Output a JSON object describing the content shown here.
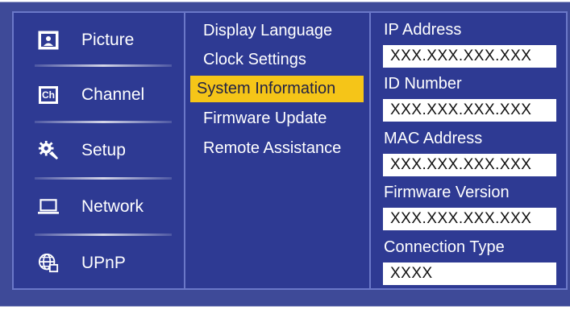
{
  "nav": {
    "items": [
      {
        "label": "Picture",
        "icon": "picture-icon"
      },
      {
        "label": "Channel",
        "icon": "channel-icon",
        "icon_text": "Ch"
      },
      {
        "label": "Setup",
        "icon": "gear-wrench-icon"
      },
      {
        "label": "Network",
        "icon": "laptop-icon"
      },
      {
        "label": "UPnP",
        "icon": "globe-network-icon"
      }
    ]
  },
  "submenu": {
    "items": [
      {
        "label": "Display Language"
      },
      {
        "label": "Clock Settings"
      },
      {
        "label": "System Information",
        "selected": true
      },
      {
        "label": "Firmware Update"
      },
      {
        "label": "Remote Assistance"
      }
    ]
  },
  "info": {
    "fields": [
      {
        "label": "IP Address",
        "value": "XXX.XXX.XXX.XXX"
      },
      {
        "label": "ID Number",
        "value": "XXX.XXX.XXX.XXX"
      },
      {
        "label": "MAC Address",
        "value": "XXX.XXX.XXX.XXX"
      },
      {
        "label": "Firmware Version",
        "value": "XXX.XXX.XXX.XXX"
      },
      {
        "label": "Connection Type",
        "value": "XXXX"
      }
    ]
  },
  "colors": {
    "panel_bg": "#2e3a93",
    "border": "#6b78c8",
    "highlight": "#f5c518",
    "text": "#ffffff"
  }
}
